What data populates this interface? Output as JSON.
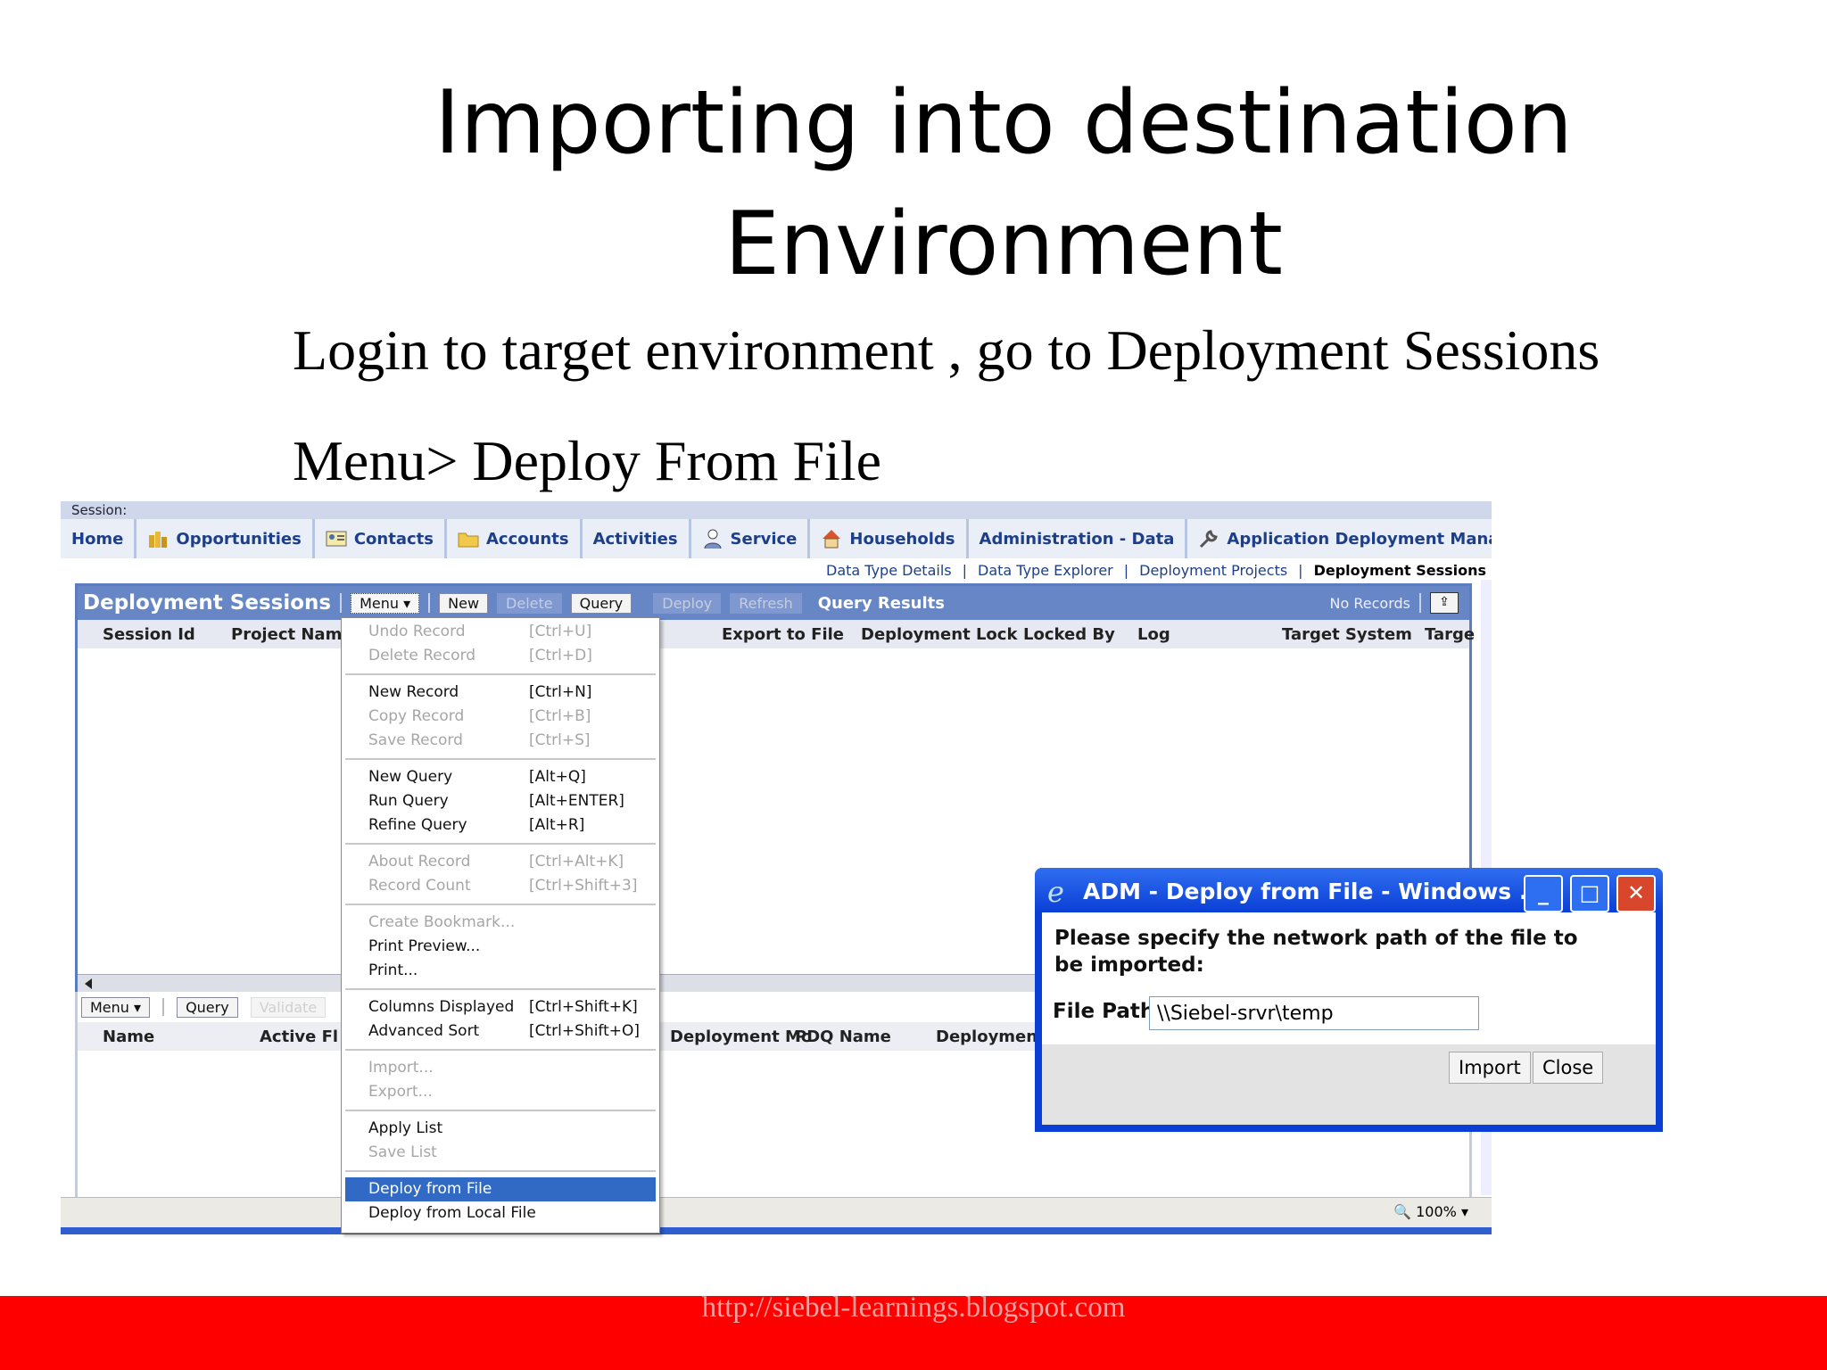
{
  "slide": {
    "title_line1": "Importing into destination",
    "title_line2": "Environment",
    "line1": "Login to target environment , go to Deployment Sessions",
    "line2": "Menu> Deploy From File",
    "footer_url": "http://siebel-learnings.blogspot.com"
  },
  "app": {
    "session_label": "Session:",
    "tabs": [
      {
        "label": "Home",
        "icon": ""
      },
      {
        "label": "Opportunities",
        "icon": "coins-icon"
      },
      {
        "label": "Contacts",
        "icon": "contact-card-icon"
      },
      {
        "label": "Accounts",
        "icon": "folder-icon"
      },
      {
        "label": "Activities",
        "icon": ""
      },
      {
        "label": "Service",
        "icon": "person-icon"
      },
      {
        "label": "Households",
        "icon": "house-icon"
      },
      {
        "label": "Administration - Data",
        "icon": ""
      },
      {
        "label": "Application Deployment Manager",
        "icon": "wrench-icon"
      }
    ],
    "subnav": {
      "item1": "Data Type Details",
      "item2": "Data Type Explorer",
      "item3": "Deployment Projects",
      "item4": "Deployment Sessions",
      "separator": "|"
    },
    "applet1": {
      "title": "Deployment Sessions",
      "menu_btn": "Menu",
      "new_btn": "New",
      "delete_btn": "Delete",
      "query_btn": "Query",
      "deploy_btn": "Deploy",
      "refresh_btn": "Refresh",
      "query_results": "Query Results",
      "no_records": "No Records",
      "columns": [
        "Session Id",
        "Project Name",
        "Export to File",
        "Deployment Lock",
        "Locked By",
        "Log",
        "Target System",
        "Targe"
      ]
    },
    "applet2": {
      "menu_btn": "Menu",
      "query_btn": "Query",
      "validate_btn": "Validate",
      "columns": [
        "Name",
        "Active Fl",
        "Deployment Mc",
        "PDQ Name",
        "Deployment"
      ]
    },
    "zoom": "100%"
  },
  "menu": {
    "items": [
      {
        "label": "Undo Record",
        "shortcut": "[Ctrl+U]"
      },
      {
        "label": "Delete Record",
        "shortcut": "[Ctrl+D]"
      },
      {
        "label": "New Record",
        "shortcut": "[Ctrl+N]"
      },
      {
        "label": "Copy Record",
        "shortcut": "[Ctrl+B]"
      },
      {
        "label": "Save Record",
        "shortcut": "[Ctrl+S]"
      },
      {
        "label": "New Query",
        "shortcut": "[Alt+Q]"
      },
      {
        "label": "Run Query",
        "shortcut": "[Alt+ENTER]"
      },
      {
        "label": "Refine Query",
        "shortcut": "[Alt+R]"
      },
      {
        "label": "About Record",
        "shortcut": "[Ctrl+Alt+K]"
      },
      {
        "label": "Record Count",
        "shortcut": "[Ctrl+Shift+3]"
      },
      {
        "label": "Create Bookmark...",
        "shortcut": ""
      },
      {
        "label": "Print Preview...",
        "shortcut": ""
      },
      {
        "label": "Print...",
        "shortcut": ""
      },
      {
        "label": "Columns Displayed",
        "shortcut": "[Ctrl+Shift+K]"
      },
      {
        "label": "Advanced Sort",
        "shortcut": "[Ctrl+Shift+O]"
      },
      {
        "label": "Import...",
        "shortcut": ""
      },
      {
        "label": "Export...",
        "shortcut": ""
      },
      {
        "label": "Apply List",
        "shortcut": ""
      },
      {
        "label": "Save List",
        "shortcut": ""
      },
      {
        "label": "Deploy from File",
        "shortcut": ""
      },
      {
        "label": "Deploy from Local File",
        "shortcut": ""
      }
    ]
  },
  "dialog": {
    "title": "ADM - Deploy from File - Windows ...",
    "message": "Please specify the network path of the file to be imported:",
    "file_path_label": "File Path",
    "file_path_value": "\\\\Siebel-srvr\\temp",
    "import_btn": "Import",
    "close_btn": "Close",
    "min_glyph": "_",
    "max_glyph": "□",
    "close_glyph": "✕"
  },
  "colors": {
    "footer_bar": "#ff0000",
    "applet_header": "#6686c6",
    "selected_menu": "#316ac5",
    "dialog_frame": "#0a3fd6"
  }
}
